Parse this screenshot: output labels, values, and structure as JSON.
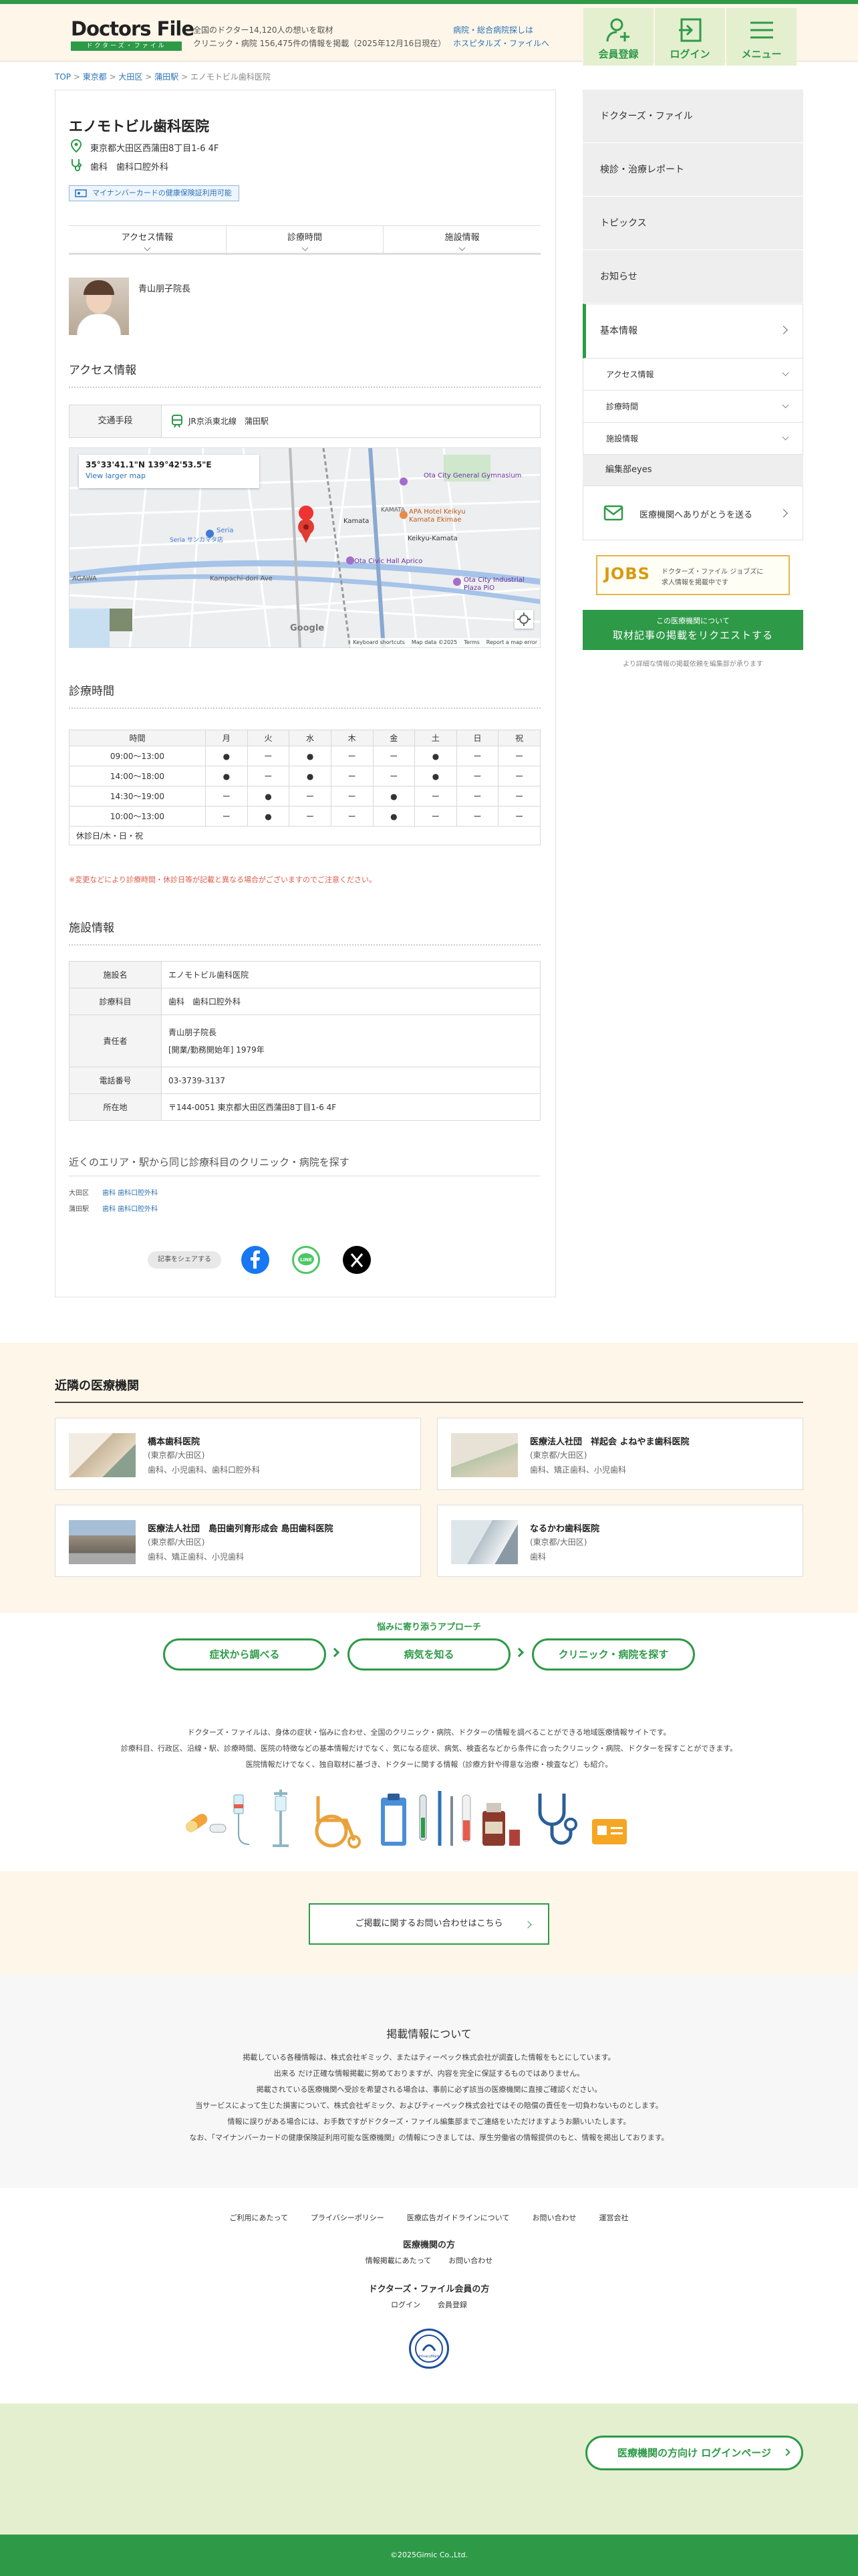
{
  "header": {
    "logo": "Doctors File",
    "logo_sub": "ドクターズ・ファイル",
    "tagline1": "全国のドクター14,120人の想いを取材",
    "tagline2": "クリニック・病院 156,475件の情報を掲載（2025年12月16日現在）",
    "hosp_link1": "病院・総合病院探しは",
    "hosp_link2": "ホスピタルズ・ファイルへ",
    "btn_register": "会員登録",
    "btn_login": "ログイン",
    "btn_menu": "メニュー"
  },
  "breadcrumb": [
    "TOP",
    "東京都",
    "大田区",
    "蒲田駅",
    "エノモトビル歯科医院"
  ],
  "clinic": {
    "name": "エノモトビル歯科医院",
    "address": "東京都大田区西蒲田8丁目1-6 4F",
    "subjects": "歯科　歯科口腔外科",
    "badge": "マイナンバーカードの健康保険証利用可能",
    "tabs": [
      "アクセス情報",
      "診療時間",
      "施設情報"
    ],
    "doctor": "青山朋子院長"
  },
  "access": {
    "title": "アクセス情報",
    "label": "交通手段",
    "value": "JR京浜東北線　蒲田駅",
    "map_coord": "35°33'41.1\"N 139°42'53.5\"E",
    "map_link": "View larger map",
    "map_labels": [
      "Ota City General Gymnasium",
      "APA Hotel Keikyu Kamata Ekimae",
      "KAMATA",
      "Kamata",
      "Keikyu-Kamata",
      "Ota Civic Hall Aprico",
      "Ota City Industrial Plaza PiO",
      "Seria",
      "Seria サンカマタ店",
      "AGAWA",
      "Kampachi-dori Ave"
    ],
    "map_footer": [
      "Keyboard shortcuts",
      "Map data ©2025",
      "Terms",
      "Report a map error"
    ],
    "google": "Google"
  },
  "hours": {
    "title": "診療時間",
    "head": [
      "時間",
      "月",
      "火",
      "水",
      "木",
      "金",
      "土",
      "日",
      "祝"
    ],
    "rows": [
      [
        "09:00〜13:00",
        "●",
        "ー",
        "●",
        "ー",
        "ー",
        "●",
        "ー",
        "ー"
      ],
      [
        "14:00〜18:00",
        "●",
        "ー",
        "●",
        "ー",
        "ー",
        "●",
        "ー",
        "ー"
      ],
      [
        "14:30〜19:00",
        "ー",
        "●",
        "ー",
        "ー",
        "●",
        "ー",
        "ー",
        "ー"
      ],
      [
        "10:00〜13:00",
        "ー",
        "●",
        "ー",
        "ー",
        "●",
        "ー",
        "ー",
        "ー"
      ]
    ],
    "closed": "休診日/木・日・祝",
    "note": "※変更などにより診療時間・休診日等が記載と異なる場合がございますのでご注意ください。"
  },
  "facility": {
    "title": "施設情報",
    "rows": [
      {
        "k": "施設名",
        "v": "エノモトビル歯科医院"
      },
      {
        "k": "診療科目",
        "v": "歯科　歯科口腔外科"
      },
      {
        "k": "責任者",
        "v": "青山朋子院長",
        "v2": "[開業/勤務開始年] 1979年"
      },
      {
        "k": "電話番号",
        "v": "03-3739-3137"
      },
      {
        "k": "所在地",
        "v": "〒144-0051 東京都大田区西蒲田8丁目1-6 4F"
      }
    ]
  },
  "search": {
    "title": "近くのエリア・駅から同じ診療科目のクリニック・病院を探す",
    "rows": [
      {
        "area": "大田区",
        "links": "歯科  歯科口腔外科"
      },
      {
        "area": "蒲田駅",
        "links": "歯科  歯科口腔外科"
      }
    ],
    "share": "記事をシェアする"
  },
  "sidebar": {
    "items": [
      "ドクターズ・ファイル",
      "検診・治療レポート",
      "トピックス",
      "お知らせ"
    ],
    "basic": "基本情報",
    "subs": [
      "アクセス情報",
      "診療時間",
      "施設情報"
    ],
    "editor": "編集部eyes",
    "thanks": "医療機関へありがとうを送る",
    "jobs_logo": "JOBS",
    "jobs1": "ドクターズ・ファイル ジョブズに",
    "jobs2": "求人情報を掲載中です",
    "req_small": "この医療機関について",
    "req_big": "取材記事の掲載をリクエストする",
    "req_note": "より詳細な情報の掲載依頼を編集部が承ります"
  },
  "nearby": {
    "title": "近隣の医療機関",
    "cards": [
      {
        "name": "橋本歯科医院",
        "addr": "(東京都/大田区)",
        "subj": "歯科、小児歯科、歯科口腔外科"
      },
      {
        "name": "医療法人社団　祥起会 よねやま歯科医院",
        "addr": "(東京都/大田区)",
        "subj": "歯科、矯正歯科、小児歯科"
      },
      {
        "name": "医療法人社団　島田歯列育形成会 島田歯科医院",
        "addr": "(東京都/大田区)",
        "subj": "歯科、矯正歯科、小児歯科"
      },
      {
        "name": "なるかわ歯科医院",
        "addr": "(東京都/大田区)",
        "subj": "歯科"
      }
    ]
  },
  "approach": {
    "title": "悩みに寄り添うアプローチ",
    "btns": [
      "症状から調べる",
      "病気を知る",
      "クリニック・病院を探す"
    ]
  },
  "about": {
    "l1": "ドクターズ・ファイルは、身体の症状・悩みに合わせ、全国のクリニック・病院、ドクターの情報を調べることができる地域医療情報サイトです。",
    "l2": "診療科目、行政区、沿線・駅、診療時間、医院の特徴などの基本情報だけでなく、気になる症状、病気、検査名などから条件に合ったクリニック・病院、ドクターを探すことができます。",
    "l3": "医院情報だけでなく、独自取材に基づき、ドクターに関する情報（診療方針や得意な治療・検査など）も紹介。"
  },
  "contact": "ご掲載に関するお問い合わせはこちら",
  "disclaimer": {
    "title": "掲載情報について",
    "lines": [
      "掲載している各種情報は、株式会社ギミック、またはティーペック株式会社が調査した情報をもとにしています。",
      "出来る だけ正確な情報掲載に努めておりますが、内容を完全に保証するものではありません。",
      "掲載されている医療機関へ受診を希望される場合は、事前に必ず該当の医療機関に直接ご確認ください。",
      "当サービスによって生じた損害について、株式会社ギミック、およびティーペック株式会社ではその賠償の責任を一切負わないものとします。",
      "情報に誤りがある場合には、お手数ですがドクターズ・ファイル編集部までご連絡をいただけますようお願いいたします。",
      "なお、「マイナンバーカードの健康保険証利用可能な医療機関」の情報につきましては、厚生労働省の情報提供のもと、情報を掲出しております。"
    ]
  },
  "footer": {
    "links": [
      "ご利用にあたって",
      "プライバシーポリシー",
      "医療広告ガイドラインについて",
      "お問い合わせ",
      "運営会社"
    ],
    "med_title": "医療機関の方",
    "med_links": [
      "情報掲載にあたって",
      "お問い合わせ"
    ],
    "mem_title": "ドクターズ・ファイル会員の方",
    "mem_links": [
      "ログイン",
      "会員登録"
    ],
    "privacy_mark": "PrivacyMark",
    "login_btn": "医療機関の方向け ログインページ",
    "copyright": "©2025Gimic Co.,Ltd."
  },
  "colors": {
    "brand": "#2e9a48",
    "link": "#2b72b8",
    "cream": "#fdf6e9"
  }
}
